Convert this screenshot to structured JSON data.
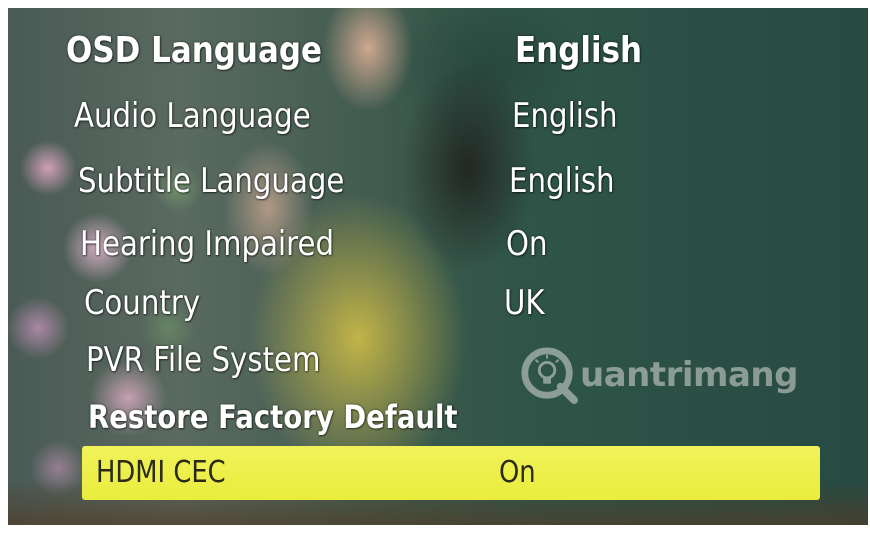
{
  "menu": {
    "items": [
      {
        "label": "OSD Language",
        "value": "English"
      },
      {
        "label": "Audio Language",
        "value": "English"
      },
      {
        "label": "Subtitle Language",
        "value": "English"
      },
      {
        "label": "Hearing Impaired",
        "value": "On"
      },
      {
        "label": "Country",
        "value": "UK"
      },
      {
        "label": "PVR File System",
        "value": ""
      },
      {
        "label": "Restore Factory Default",
        "value": ""
      },
      {
        "label": "HDMI CEC",
        "value": "On"
      }
    ],
    "selected_index": 7,
    "highlight_color": "#eef04a"
  },
  "watermark": {
    "text": "uantrimang",
    "icon": "lightbulb-q-logo"
  }
}
